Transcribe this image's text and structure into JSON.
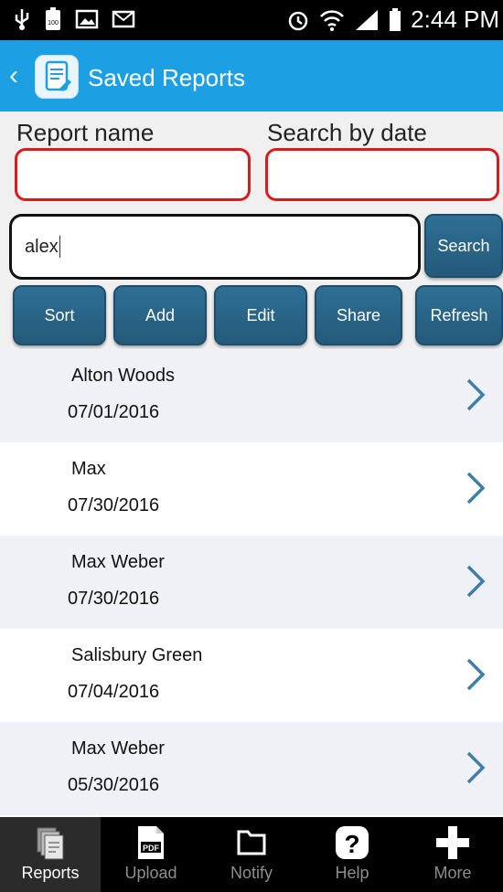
{
  "status_bar": {
    "time": "2:44 PM",
    "battery_level": "100",
    "left_icons": [
      "usb-icon",
      "battery-100-icon",
      "image-icon",
      "email-icon"
    ],
    "right_icons": [
      "alarm-icon",
      "wifi-icon",
      "signal-icon",
      "battery-icon"
    ]
  },
  "app_bar": {
    "title": "Saved Reports"
  },
  "form": {
    "report_name_label": "Report name",
    "search_by_date_label": "Search by date",
    "search_value": "alex",
    "search_button": "Search"
  },
  "actions": {
    "sort": "Sort",
    "add": "Add",
    "edit": "Edit",
    "share": "Share",
    "refresh": "Refresh"
  },
  "reports": [
    {
      "name": "Alton Woods",
      "date": "07/01/2016"
    },
    {
      "name": "Max",
      "date": "07/30/2016"
    },
    {
      "name": "Max Weber",
      "date": "07/30/2016"
    },
    {
      "name": "Salisbury Green",
      "date": "07/04/2016"
    },
    {
      "name": "Max Weber",
      "date": "05/30/2016"
    }
  ],
  "tab_bar": {
    "reports": "Reports",
    "upload": "Upload",
    "notify": "Notify",
    "help": "Help",
    "more": "More",
    "pdf_text": "PDF"
  },
  "colors": {
    "app_bar": "#1d9fe4",
    "button": "#2f6f95",
    "field_border": "#d91b1b",
    "row_alt": "#f0f0f7"
  }
}
